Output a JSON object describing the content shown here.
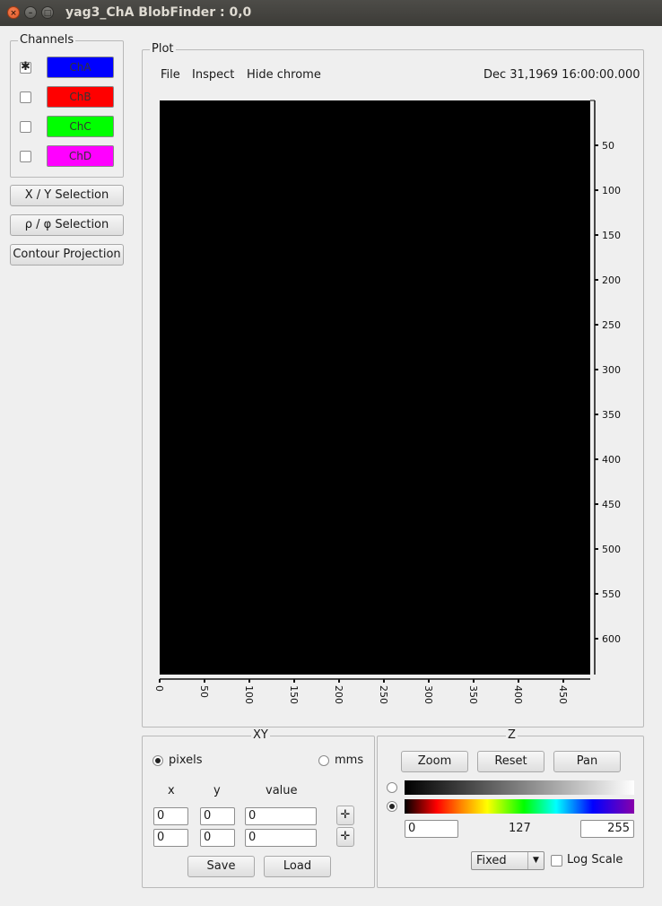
{
  "window": {
    "title": "yag3_ChA BlobFinder : 0,0",
    "close_glyph": "×",
    "min_glyph": "–",
    "max_glyph": "□"
  },
  "channels": {
    "legend": "Channels",
    "items": [
      {
        "label": "ChA",
        "checked": true,
        "color": "#0000ff"
      },
      {
        "label": "ChB",
        "checked": false,
        "color": "#ff0000"
      },
      {
        "label": "ChC",
        "checked": false,
        "color": "#00ff00"
      },
      {
        "label": "ChD",
        "checked": false,
        "color": "#ff00ff"
      }
    ]
  },
  "actions": {
    "xy_selection": "X / Y Selection",
    "rho_phi_selection": "ρ / φ Selection",
    "contour_projection": "Contour Projection"
  },
  "plot": {
    "legend": "Plot",
    "menu": {
      "file": "File",
      "inspect": "Inspect",
      "hide_chrome": "Hide chrome"
    },
    "timestamp": "Dec 31,1969 16:00:00.000",
    "image_background": "#000000",
    "y_ticks": [
      "50",
      "100",
      "150",
      "200",
      "250",
      "300",
      "350",
      "400",
      "450",
      "500",
      "550",
      "600"
    ],
    "x_ticks": [
      "0",
      "50",
      "100",
      "150",
      "200",
      "250",
      "300",
      "350",
      "400",
      "450"
    ]
  },
  "xy": {
    "legend": "XY",
    "pixels_label": "pixels",
    "mms_label": "mms",
    "unit_selected": "pixels",
    "col_x": "x",
    "col_y": "y",
    "col_value": "value",
    "rows": [
      {
        "x": "0",
        "y": "0",
        "value": "0"
      },
      {
        "x": "0",
        "y": "0",
        "value": "0"
      }
    ],
    "crosshair_glyph": "✛",
    "save_label": "Save",
    "load_label": "Load"
  },
  "z": {
    "legend": "Z",
    "zoom_label": "Zoom",
    "reset_label": "Reset",
    "pan_label": "Pan",
    "colormap_selected": "rainbow",
    "min_value": "0",
    "mid_value": "127",
    "max_value": "255",
    "scale_mode": "Fixed",
    "log_scale_label": "Log Scale",
    "log_scale_checked": false
  }
}
